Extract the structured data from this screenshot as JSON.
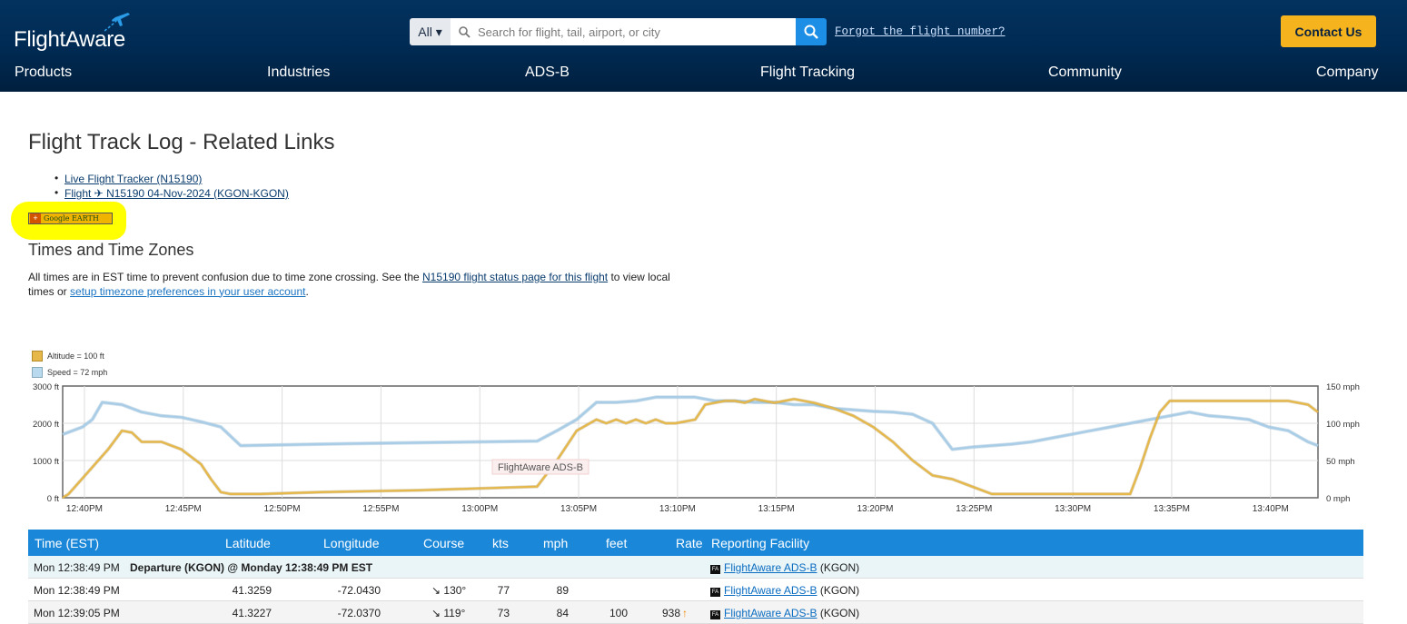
{
  "header": {
    "logo_text": "FlightAware",
    "search_scope": "All ▾",
    "search_placeholder": "Search for flight, tail, airport, or city",
    "forgot_link": "Forgot the flight number?",
    "contact_button": "Contact Us",
    "nav": [
      "Products",
      "Industries",
      "ADS-B",
      "Flight Tracking",
      "Community",
      "Company"
    ]
  },
  "page": {
    "title": "Flight Track Log - Related Links",
    "links": [
      "Live Flight Tracker (N15190)",
      "Flight ✈ N15190 04-Nov-2024 (KGON-KGON)"
    ],
    "google_earth_label": "Google EARTH",
    "section_title": "Times and Time Zones",
    "para_1": "All times are in EST time to prevent confusion due to time zone crossing. See the ",
    "para_link_1": "N15190 flight status page for this flight",
    "para_2": " to view local times or ",
    "para_link_2": "setup timezone preferences in your user account",
    "para_3": "."
  },
  "chart_data": {
    "type": "line",
    "legend": [
      "Altitude = 100 ft",
      "Speed = 72 mph"
    ],
    "watermark": "FlightAware ADS-B",
    "x_ticks": [
      "12:40PM",
      "12:45PM",
      "12:50PM",
      "12:55PM",
      "13:00PM",
      "13:05PM",
      "13:10PM",
      "13:15PM",
      "13:20PM",
      "13:25PM",
      "13:30PM",
      "13:35PM",
      "13:40PM"
    ],
    "y_left_ticks": [
      "0 ft",
      "1000 ft",
      "2000 ft",
      "3000 ft"
    ],
    "y_right_ticks": [
      "0 mph",
      "50 mph",
      "100 mph",
      "150 mph"
    ],
    "xlim_minutes": [
      0,
      63.5
    ],
    "ylim_ft": [
      0,
      3000
    ],
    "ylim_mph": [
      0,
      150
    ],
    "colors": {
      "altitude": "#e6b84a",
      "speed": "#a9cde6"
    },
    "series": [
      {
        "name": "Altitude = 100 ft",
        "x_minutes": [
          0,
          0.3,
          1.3,
          2.3,
          3,
          3.5,
          4,
          5,
          6,
          7,
          7.5,
          8,
          8.5,
          9,
          10,
          13,
          18,
          24,
          25,
          26,
          27,
          27.5,
          28,
          28.5,
          29,
          29.5,
          30,
          30.5,
          31,
          32,
          32.5,
          33,
          33.5,
          34,
          34.5,
          35,
          36,
          37,
          38,
          39,
          40,
          41,
          42,
          43,
          44,
          45,
          46,
          47,
          48,
          49,
          50,
          51,
          52,
          53,
          54,
          54.5,
          55,
          55.5,
          56,
          57,
          57.5,
          58,
          58.5,
          59,
          60,
          61,
          62,
          63,
          63.5
        ],
        "values": [
          0,
          100,
          700,
          1300,
          1800,
          1750,
          1500,
          1500,
          1300,
          900,
          500,
          150,
          100,
          100,
          100,
          150,
          200,
          300,
          1000,
          1800,
          2100,
          2000,
          2100,
          2000,
          2100,
          2000,
          2100,
          2000,
          2000,
          2100,
          2500,
          2550,
          2600,
          2600,
          2550,
          2650,
          2550,
          2650,
          2550,
          2400,
          2200,
          1900,
          1500,
          1000,
          600,
          500,
          300,
          100,
          100,
          100,
          100,
          100,
          100,
          100,
          100,
          800,
          1600,
          2300,
          2600,
          2600,
          2600,
          2600,
          2600,
          2600,
          2600,
          2600,
          2600,
          2500,
          2300
        ],
        "unit": "ft"
      },
      {
        "name": "Speed = 72 mph",
        "x_minutes": [
          0,
          0.5,
          1,
          1.5,
          2,
          3,
          4,
          5,
          6,
          7,
          8,
          9,
          13,
          18,
          24,
          25,
          26,
          27,
          28,
          29,
          30,
          31,
          32,
          33,
          34,
          35,
          36,
          37,
          38,
          39,
          40,
          41,
          42,
          43,
          44,
          45,
          46,
          47,
          48,
          49,
          50,
          51,
          52,
          53,
          54,
          55,
          56,
          57,
          58,
          59,
          60,
          61,
          62,
          63,
          63.5
        ],
        "values": [
          85,
          90,
          95,
          105,
          128,
          125,
          115,
          110,
          108,
          102,
          95,
          70,
          72,
          74,
          76,
          90,
          105,
          128,
          128,
          130,
          135,
          135,
          135,
          130,
          130,
          128,
          128,
          125,
          125,
          120,
          118,
          116,
          115,
          112,
          100,
          65,
          68,
          70,
          72,
          75,
          80,
          85,
          90,
          95,
          100,
          105,
          110,
          115,
          110,
          108,
          105,
          95,
          90,
          75,
          70
        ],
        "unit": "mph"
      }
    ]
  },
  "table": {
    "headers": [
      "Time (EST)",
      "Latitude",
      "Longitude",
      "Course",
      "kts",
      "mph",
      "feet",
      "Rate",
      "Reporting Facility"
    ],
    "departure_row": {
      "time": "Mon 12:38:49 PM",
      "label": "Departure (KGON) @ Monday 12:38:49 PM EST",
      "facility_link": "FlightAware ADS-B",
      "facility_code": "(KGON)"
    },
    "rows": [
      {
        "time": "Mon 12:38:49 PM",
        "lat": "41.3259",
        "lon": "-72.0430",
        "course": "↘ 130°",
        "kts": "77",
        "mph": "89",
        "feet": "",
        "rate": "",
        "facility_link": "FlightAware ADS-B",
        "facility_code": "(KGON)"
      },
      {
        "time": "Mon 12:39:05 PM",
        "lat": "41.3227",
        "lon": "-72.0370",
        "course": "↘ 119°",
        "kts": "73",
        "mph": "84",
        "feet": "100",
        "rate": "938",
        "facility_link": "FlightAware ADS-B",
        "facility_code": "(KGON)"
      }
    ]
  }
}
